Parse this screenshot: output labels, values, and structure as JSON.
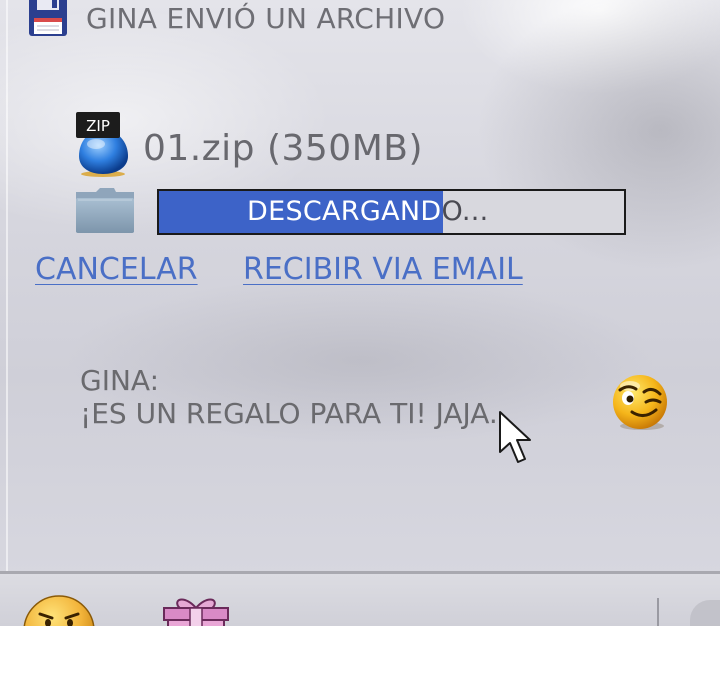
{
  "window": {
    "title": "GINA ENVIÓ UN ARCHIVO",
    "title_icon": "floppy-disk-icon"
  },
  "file": {
    "type_badge": "ZIP",
    "name": "01.zip (350MB)",
    "icon": "zip-file-icon",
    "folder_icon": "folder-icon"
  },
  "download": {
    "status_text": "DESCARGANDO...",
    "progress_percent": 61,
    "fill_color": "#3d63c8"
  },
  "actions": {
    "cancel_label": "CANCELAR",
    "email_label": "RECIBIR VIA EMAIL",
    "link_color": "#4a6fc6"
  },
  "message": {
    "sender": "GINA:",
    "text": "¡ES UN REGALO PARA TI! JAJA.",
    "emoticon": "wink-emoticon-icon"
  },
  "toolbar": {
    "items": [
      {
        "icon": "angry-emoticon-icon"
      },
      {
        "icon": "gift-icon"
      }
    ]
  }
}
